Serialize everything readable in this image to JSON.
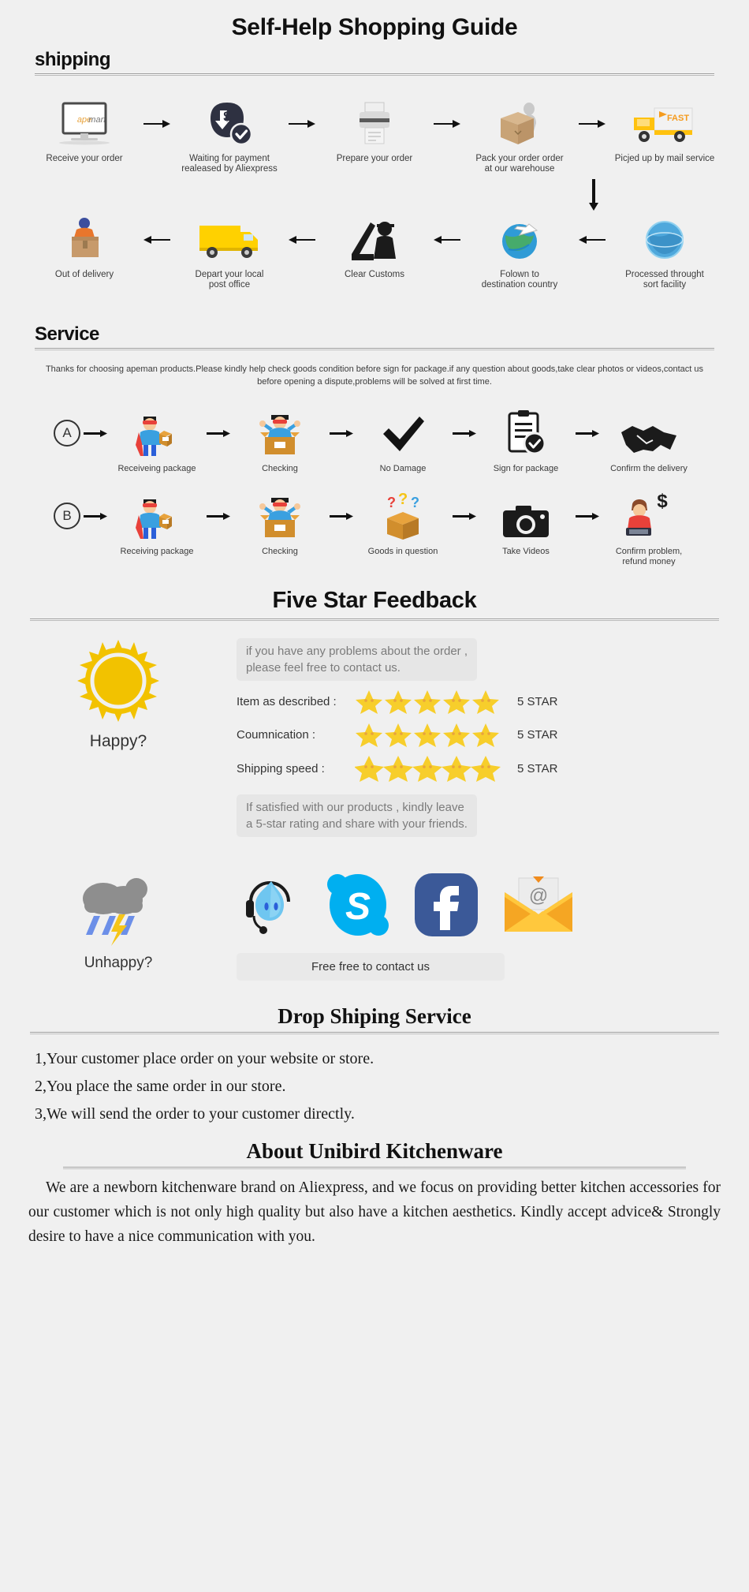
{
  "page": {
    "title": "Self-Help Shopping Guide",
    "background": "#f0f0f0"
  },
  "shipping": {
    "heading": "shipping",
    "row1": [
      {
        "icon": "monitor-apeman-icon",
        "label": "Receive your order"
      },
      {
        "icon": "payment-released-icon",
        "label": "Waiting for payment\nrealeased by Aliexpress"
      },
      {
        "icon": "printer-icon",
        "label": "Prepare your order"
      },
      {
        "icon": "packing-box-icon",
        "label": "Pack your order order\nat our warehouse"
      },
      {
        "icon": "delivery-truck-icon",
        "label": "Picjed up by mail service"
      }
    ],
    "row2": [
      {
        "icon": "out-for-delivery-icon",
        "label": "Out of delivery"
      },
      {
        "icon": "post-truck-icon",
        "label": "Depart your local\npost office"
      },
      {
        "icon": "customs-officer-icon",
        "label": "Clear Customs"
      },
      {
        "icon": "globe-plane-icon",
        "label": "Folown to\ndestination country"
      },
      {
        "icon": "globe-sort-icon",
        "label": "Processed throught\nsort facility"
      }
    ]
  },
  "service": {
    "heading": "Service",
    "note": "Thanks for choosing apeman products.Please kindly help check goods condition before sign for package.if any question about goods,take clear photos or videos,contact us before opening a dispute,problems will be solved at first time.",
    "rowA": {
      "badge": "A",
      "steps": [
        {
          "icon": "hero-package-icon",
          "label": "Receiveing package"
        },
        {
          "icon": "hero-open-box-icon",
          "label": "Checking"
        },
        {
          "icon": "checkmark-icon",
          "label": "No Damage"
        },
        {
          "icon": "clipboard-sign-icon",
          "label": "Sign for package"
        },
        {
          "icon": "handshake-icon",
          "label": "Confirm the delivery"
        }
      ]
    },
    "rowB": {
      "badge": "B",
      "steps": [
        {
          "icon": "hero-package-icon",
          "label": "Receiving package"
        },
        {
          "icon": "hero-open-box-icon",
          "label": "Checking"
        },
        {
          "icon": "question-box-icon",
          "label": "Goods in question"
        },
        {
          "icon": "camera-icon",
          "label": "Take Videos"
        },
        {
          "icon": "refund-money-icon",
          "label": "Confirm problem,\nrefund money"
        }
      ]
    }
  },
  "feedback": {
    "heading": "Five Star Feedback",
    "prompt": "if you have any problems about the order ,\nplease feel free to contact us.",
    "happy_label": "Happy?",
    "ratings": [
      {
        "label": "Item as described :",
        "stars": 5,
        "value": "5 STAR"
      },
      {
        "label": "Coumnication :",
        "stars": 5,
        "value": "5 STAR"
      },
      {
        "label": "Shipping speed :",
        "stars": 5,
        "value": "5 STAR"
      }
    ],
    "satisfied_note": "If satisfied with our products , kindly leave\na 5-star rating and share with your friends.",
    "unhappy_label": "Unhappy?",
    "contact_bar": "Free free to contact us",
    "social": [
      {
        "icon": "trillian-support-icon",
        "name": "support-chat"
      },
      {
        "icon": "skype-icon",
        "name": "skype"
      },
      {
        "icon": "facebook-icon",
        "name": "facebook"
      },
      {
        "icon": "email-icon",
        "name": "email"
      }
    ]
  },
  "dropshipping": {
    "heading": "Drop Shiping Service",
    "items": [
      "1,Your customer place order on your website or store.",
      "2,You place the same order in our store.",
      "3,We will send the order to your customer directly."
    ]
  },
  "about": {
    "heading": "About Unibird Kitchenware",
    "body": "We are a newborn kitchenware brand on Aliexpress, and we focus on providing better kitchen accessories for our customer which is not only high quality but also have a kitchen aesthetics. Kindly accept advice& Strongly desire to have a nice communication with you."
  },
  "colors": {
    "accent_yellow": "#F5C518",
    "sun_yellow": "#F2C200",
    "skype_blue": "#00AFF0",
    "facebook_blue": "#3B5998",
    "envelope_yellow": "#FFC83D",
    "truck_yellow": "#FFC20E",
    "dark_navy": "#2E3141"
  }
}
